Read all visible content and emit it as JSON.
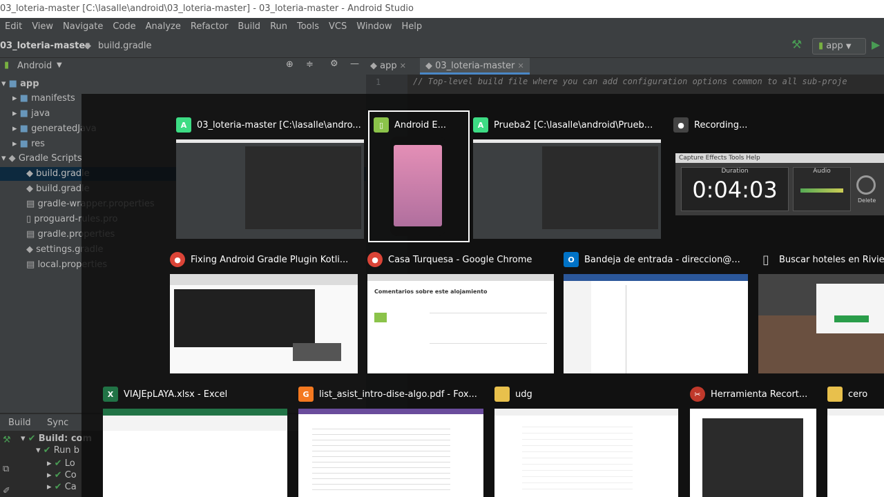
{
  "window": {
    "title": "03_loteria-master [C:\\lasalle\\android\\03_loteria-master] - 03_loteria-master - Android Studio"
  },
  "menu": [
    "Edit",
    "View",
    "Navigate",
    "Code",
    "Analyze",
    "Refactor",
    "Build",
    "Run",
    "Tools",
    "VCS",
    "Window",
    "Help"
  ],
  "breadcrumb": {
    "project": "03_loteria-master",
    "file": "build.gradle"
  },
  "run_config": {
    "label": "app"
  },
  "project_panel": {
    "view_label": "Android"
  },
  "tree": [
    {
      "label": "app"
    },
    {
      "label": "manifests"
    },
    {
      "label": "java"
    },
    {
      "label": "generatedJava"
    },
    {
      "label": "res"
    },
    {
      "label": "Gradle Scripts"
    },
    {
      "label": "build.gradle"
    },
    {
      "label": "build.gradle"
    },
    {
      "label": "gradle-wrapper.properties"
    },
    {
      "label": "proguard-rules.pro"
    },
    {
      "label": "gradle.properties"
    },
    {
      "label": "settings.gradle"
    },
    {
      "label": "local.properties"
    }
  ],
  "editor": {
    "tabs": [
      {
        "label": "app"
      },
      {
        "label": "03_loteria-master"
      }
    ],
    "line_number": "1",
    "code_line": "// Top-level build file where you can add configuration options common to all sub-proje"
  },
  "bottom_panel": {
    "tabs": [
      "Build",
      "Sync"
    ],
    "rows": [
      "Build: com",
      "Run b",
      "Lo",
      "Co",
      "Ca"
    ]
  },
  "task_switcher": {
    "row1": [
      {
        "title": "03_loteria-master [C:\\lasalle\\andro...",
        "icon": "android-studio-icon"
      },
      {
        "title": "Android E...",
        "icon": "android-emulator-icon"
      },
      {
        "title": "Prueba2 [C:\\lasalle\\android\\Prueb...",
        "icon": "android-studio-icon"
      },
      {
        "title": "Recording...",
        "icon": "recording-icon"
      }
    ],
    "recording": {
      "menu": [
        "Capture",
        "Effects",
        "Tools",
        "Help"
      ],
      "duration_label": "Duration",
      "audio_label": "Audio",
      "time": "0:04:03",
      "delete_label": "Delete"
    },
    "row2": [
      {
        "title": "Fixing Android Gradle Plugin Kotli...",
        "icon": "chrome-icon"
      },
      {
        "title": "Casa Turquesa - Google Chrome",
        "icon": "chrome-icon",
        "page_heading": "Comentarios sobre este alojamiento"
      },
      {
        "title": "Bandeja de entrada - direccion@...",
        "icon": "outlook-icon"
      },
      {
        "title": "Buscar hoteles en Riviera M",
        "icon": "document-icon"
      }
    ],
    "row3": [
      {
        "title": "VIAJEpLAYA.xlsx - Excel",
        "icon": "excel-icon"
      },
      {
        "title": "list_asist_intro-dise-algo.pdf - Fox...",
        "icon": "foxit-icon"
      },
      {
        "title": "udg",
        "icon": "folder-icon"
      },
      {
        "title": "Herramienta Recort...",
        "icon": "snipping-tool-icon"
      },
      {
        "title": "cero",
        "icon": "folder-icon"
      }
    ]
  },
  "colors": {
    "accent_green": "#499c54",
    "chrome_red": "#db4437",
    "outlook_blue": "#0072c6",
    "excel_green": "#217346",
    "foxit_orange": "#f47920",
    "folder_yellow": "#e8c04c"
  }
}
